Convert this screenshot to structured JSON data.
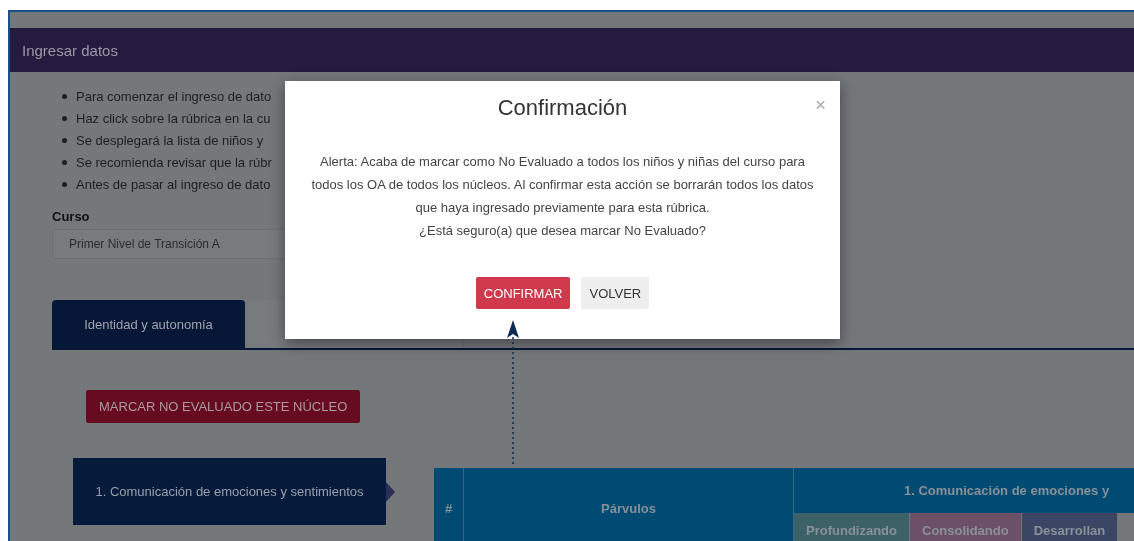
{
  "header": {
    "title": "Ingresar datos"
  },
  "instructions": [
    "Para comenzar el ingreso de dato",
    "Haz click sobre la rúbrica en la cu",
    "Se desplegará la lista de niños y",
    "Se recomienda revisar que la rúbr",
    "Antes de pasar al ingreso de dato"
  ],
  "course": {
    "label": "Curso",
    "value": "Primer Nivel de Transición A"
  },
  "tabs": [
    {
      "label": "Identidad y autonomía",
      "selected": true
    },
    {
      "selected": false
    }
  ],
  "mark_button": "MARCAR NO EVALUADO ESTE NÚCLEO",
  "nucleus_item": {
    "label": "1. Comunicación de emociones y sentimientos",
    "selected": true
  },
  "table": {
    "columns": [
      "#",
      "Párvulos"
    ],
    "group_header": "1. Comunicación de emociones y",
    "levels": [
      {
        "label": "Profundizando",
        "color": "#3c6167"
      },
      {
        "label": "Consolidando",
        "color": "#6b5068"
      },
      {
        "label": "Desarrollan",
        "color": "#3a4663"
      }
    ]
  },
  "modal": {
    "title": "Confirmación",
    "close": "×",
    "message": "Alerta: Acaba de marcar como No Evaluado a todos los niños y niñas del curso para todos los OA de todos los núcleos. Al confirmar esta acción se borrarán todos los datos que haya ingresado previamente para esta rúbrica.",
    "question": "¿Está seguro(a) que desea marcar No Evaluado?",
    "buttons": [
      {
        "label": "CONFIRMAR",
        "kind": "primary"
      },
      {
        "label": "VOLVER",
        "kind": "secondary"
      }
    ]
  }
}
